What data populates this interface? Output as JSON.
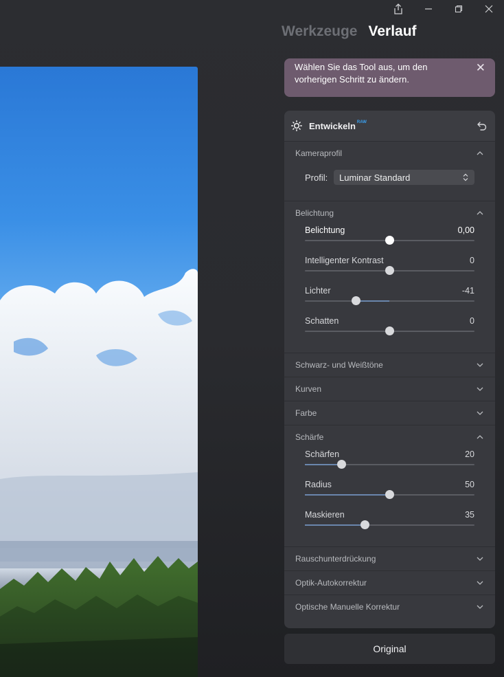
{
  "header": {
    "tabs": [
      {
        "label": "Werkzeuge",
        "active": false
      },
      {
        "label": "Verlauf",
        "active": true
      }
    ]
  },
  "window_controls": [
    "share-icon",
    "minimize-icon",
    "restore-icon",
    "close-icon"
  ],
  "tip": {
    "text": "Wählen Sie das Tool aus, um den vorherigen Schritt zu ändern."
  },
  "panel": {
    "title": "Entwickeln",
    "badge": "RAW",
    "sections": {
      "kameraprofil": {
        "title": "Kameraprofil",
        "profile_label": "Profil:",
        "profile_value": "Luminar Standard"
      },
      "belichtung": {
        "title": "Belichtung",
        "sliders": [
          {
            "label": "Belichtung",
            "value": "0,00",
            "position": 0.5,
            "fill_from": 0.5
          },
          {
            "label": "Intelligenter Kontrast",
            "value": "0",
            "position": 0.5,
            "fill_from": 0.5
          },
          {
            "label": "Lichter",
            "value": "-41",
            "position": 0.3,
            "fill_from": 0.5
          },
          {
            "label": "Schatten",
            "value": "0",
            "position": 0.5,
            "fill_from": 0.5
          }
        ]
      },
      "schwarz": {
        "title": "Schwarz- und Weißtöne"
      },
      "kurven": {
        "title": "Kurven"
      },
      "farbe": {
        "title": "Farbe"
      },
      "schaerfe": {
        "title": "Schärfe",
        "sliders": [
          {
            "label": "Schärfen",
            "value": "20",
            "position": 0.215,
            "fill_from": 0
          },
          {
            "label": "Radius",
            "value": "50",
            "position": 0.5,
            "fill_from": 0
          },
          {
            "label": "Maskieren",
            "value": "35",
            "position": 0.355,
            "fill_from": 0
          }
        ]
      },
      "rausch": {
        "title": "Rauschunterdrückung"
      },
      "optik_auto": {
        "title": "Optik-Autokorrektur"
      },
      "optik_manuell": {
        "title": "Optische Manuelle Korrektur"
      }
    }
  },
  "footer": {
    "original_label": "Original"
  },
  "colors": {
    "tip_bg": "#6e5b6e",
    "accent_badge": "#3aa0f0",
    "slider_fill": "#6a86ad"
  }
}
